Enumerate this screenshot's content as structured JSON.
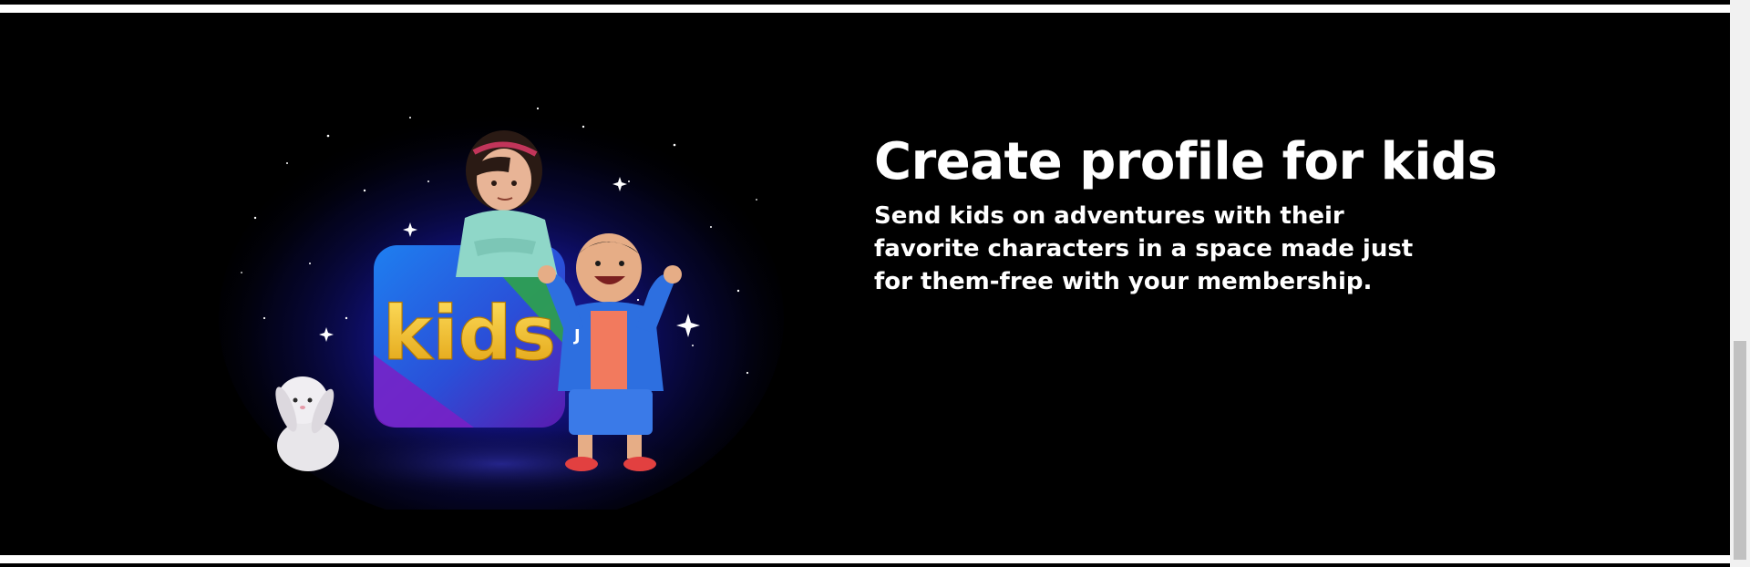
{
  "section": {
    "headline": "Create profile for kids",
    "body": "Send kids on adventures with their favorite characters in a space made just for them-free with your membership."
  },
  "illustration": {
    "logo_text": "kids",
    "jacket_letter": "J",
    "colors": {
      "background": "#000000",
      "glow": "#1a1aa8",
      "tile_blue": "#1f6fe0",
      "tile_purple": "#6a1fb8",
      "tile_green": "#2ea34a",
      "logo_yellow": "#f2c01e"
    }
  },
  "icons": [
    "sparkle-icon"
  ]
}
